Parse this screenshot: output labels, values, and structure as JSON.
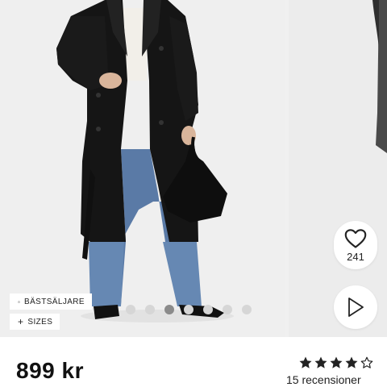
{
  "product": {
    "price": "899 kr",
    "rating": 4,
    "rating_max": 5,
    "reviews_label": "15 recensioner"
  },
  "badges": {
    "bestseller_label": "BÄSTSÄLJARE",
    "sizes_label": "SIZES",
    "sizes_icon": "plus-icon",
    "bestseller_icon": "star-outline-icon"
  },
  "gallery": {
    "slide_count": 7,
    "active_slide": 2
  },
  "actions": {
    "like_count": "241",
    "like_icon": "heart-outline-icon",
    "play_icon": "play-outline-icon"
  },
  "colors": {
    "background": "#efefef",
    "coat": "#141414",
    "jeans": "#5a7aa6",
    "text": "#111111",
    "dot_active": "#8b8b8b",
    "dot_inactive": "#d6d6d6"
  }
}
